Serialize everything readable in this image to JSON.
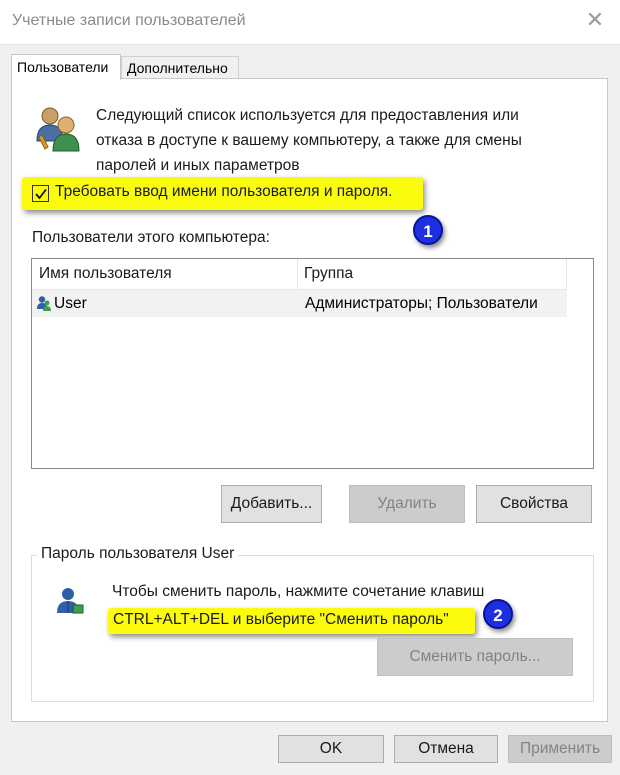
{
  "window": {
    "title": "Учетные записи пользователей",
    "close_glyph": "✕"
  },
  "tabs": [
    {
      "label": "Пользователи",
      "active": true
    },
    {
      "label": "Дополнительно",
      "active": false
    }
  ],
  "intro_text": "Следующий список используется для предоставления или отказа в доступе к вашему компьютеру, а также для смены паролей и иных параметров",
  "require_login": {
    "label": "Требовать ввод имени пользователя и пароля.",
    "checked": true
  },
  "badges": {
    "first": "1",
    "second": "2"
  },
  "users_section_label": "Пользователи этого компьютера:",
  "users_table": {
    "columns": [
      "Имя пользователя",
      "Группа"
    ],
    "rows": [
      {
        "name": "User",
        "group": "Администраторы; Пользователи"
      }
    ]
  },
  "buttons": {
    "add": "Добавить...",
    "delete": "Удалить",
    "properties": "Свойства",
    "change_password": "Сменить пароль...",
    "ok": "OK",
    "cancel": "Отмена",
    "apply": "Применить"
  },
  "password_group": {
    "title": "Пароль пользователя User",
    "line1": "Чтобы сменить пароль, нажмите сочетание клавиш",
    "line2": "CTRL+ALT+DEL и выберите \"Сменить пароль\""
  },
  "colors": {
    "highlight": "#fbfc0d",
    "badge": "#1d2fe0"
  },
  "icons": [
    "users-icon",
    "checkmark-icon",
    "user-row-icon",
    "person-icon",
    "close-icon"
  ]
}
